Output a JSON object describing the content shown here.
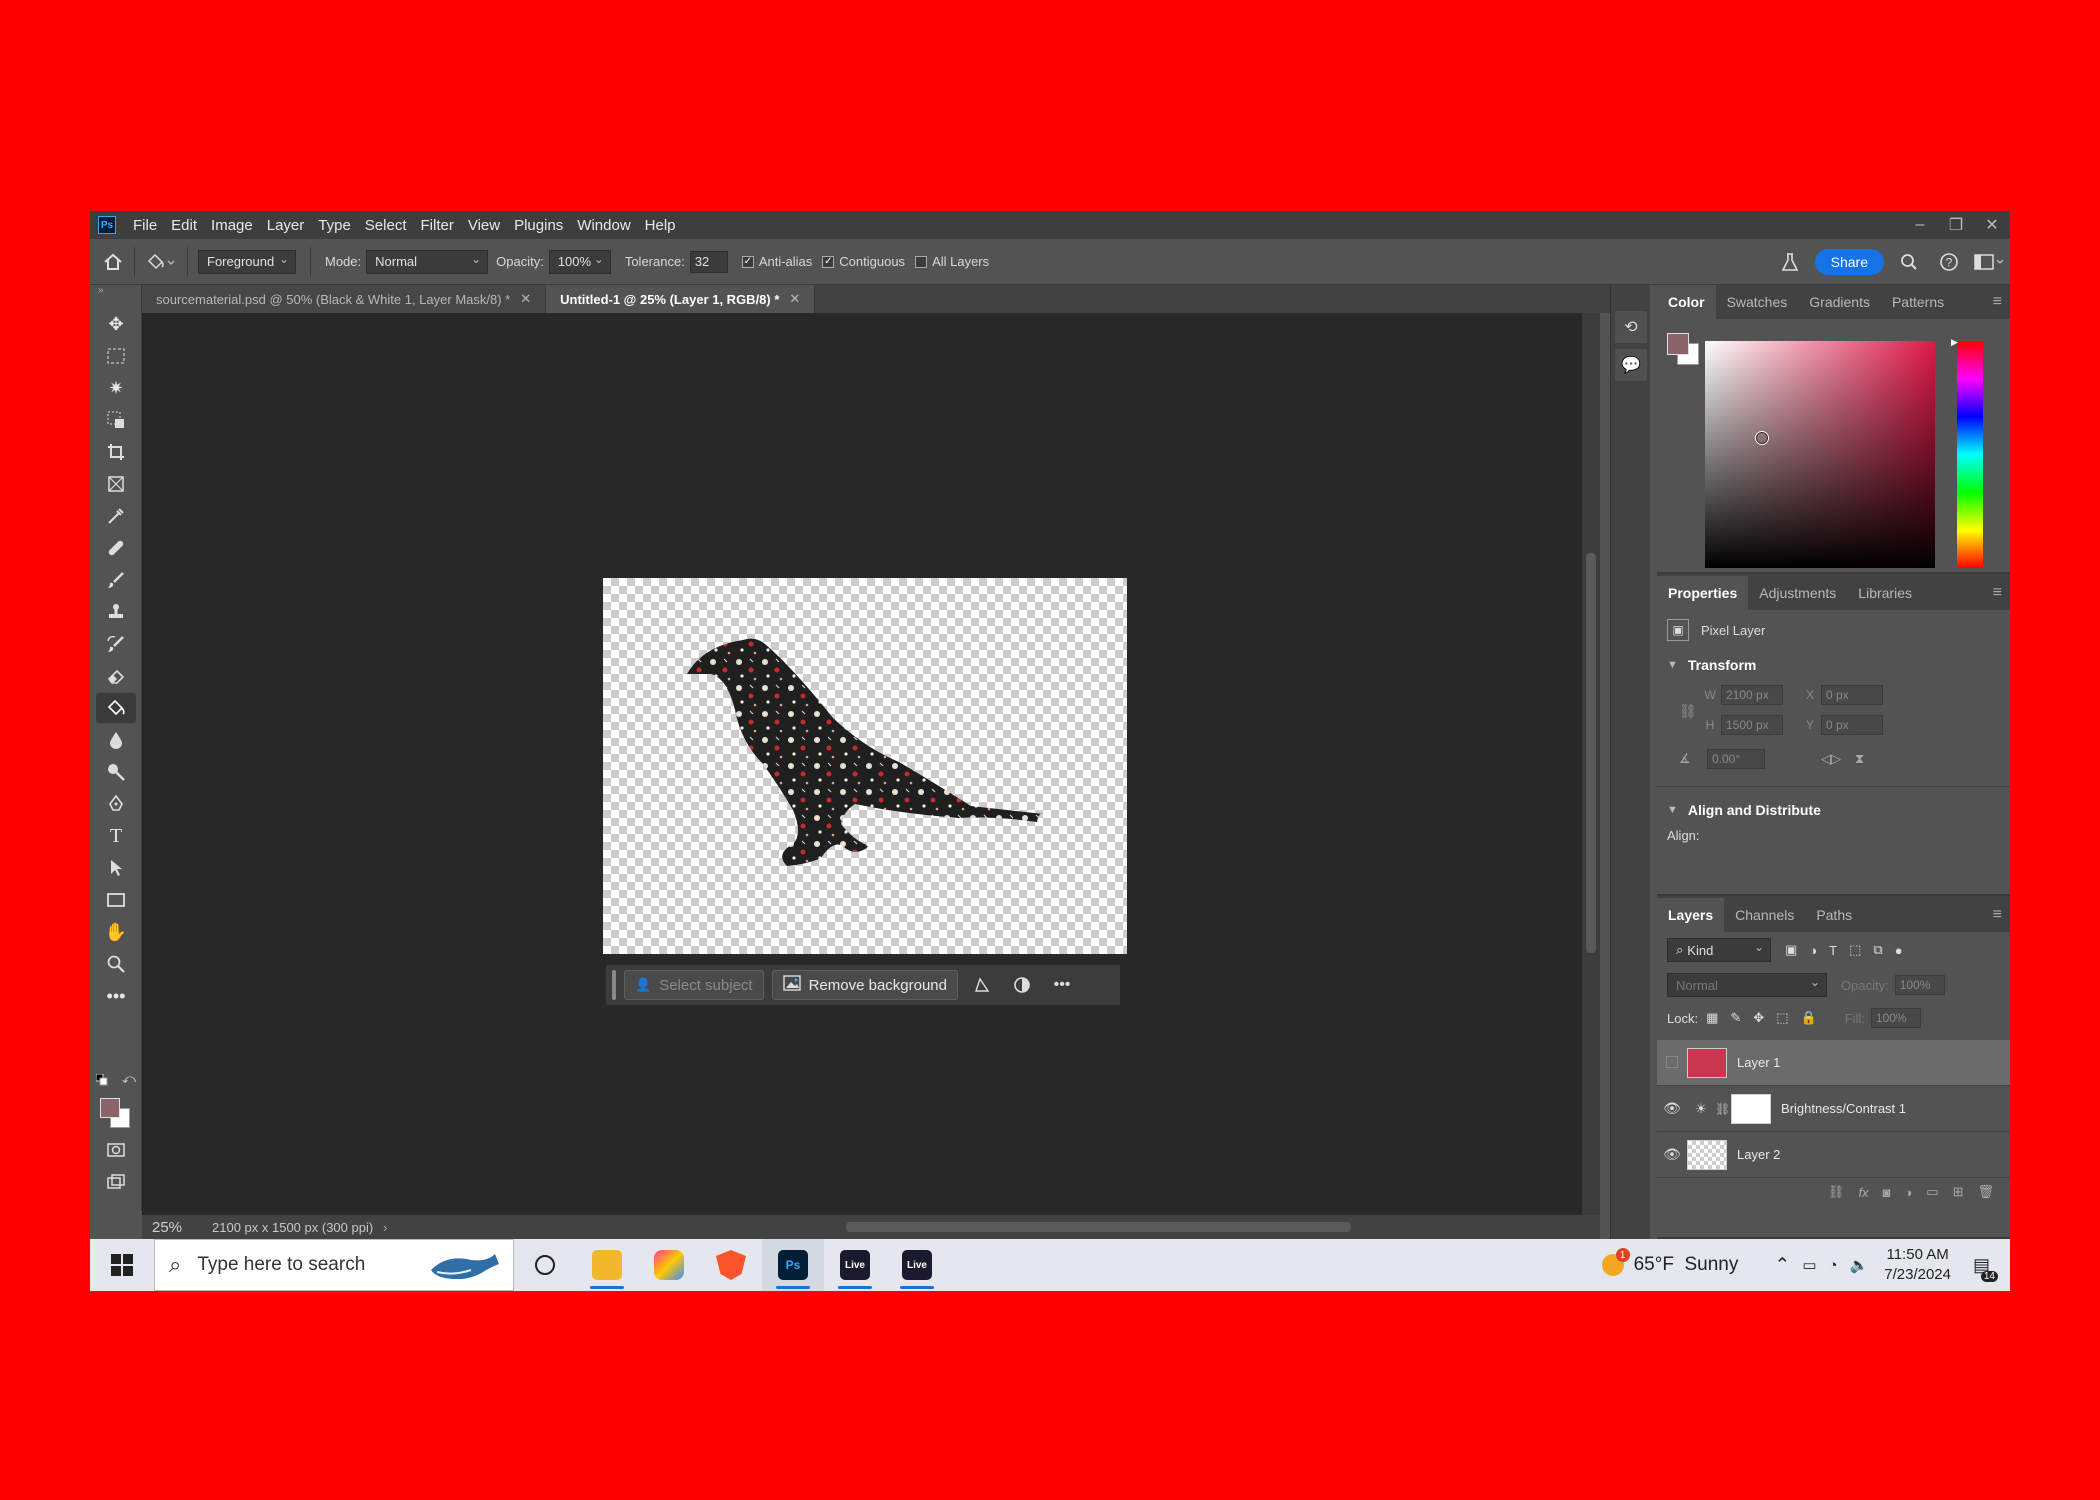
{
  "app": {
    "logo": "Ps"
  },
  "menu": [
    "File",
    "Edit",
    "Image",
    "Layer",
    "Type",
    "Select",
    "Filter",
    "View",
    "Plugins",
    "Window",
    "Help"
  ],
  "window_controls": {
    "minimize": "–",
    "restore": "❐",
    "close": "✕"
  },
  "options": {
    "fill_source": "Foreground",
    "mode_label": "Mode:",
    "mode_value": "Normal",
    "opacity_label": "Opacity:",
    "opacity_value": "100%",
    "tolerance_label": "Tolerance:",
    "tolerance_value": "32",
    "antialias_label": "Anti-alias",
    "contiguous_label": "Contiguous",
    "all_layers_label": "All Layers",
    "share_label": "Share"
  },
  "tabs": [
    {
      "label": "sourcematerial.psd @ 50% (Black & White 1, Layer Mask/8) *",
      "active": false
    },
    {
      "label": "Untitled-1 @ 25% (Layer 1, RGB/8) *",
      "active": true
    }
  ],
  "context_bar": {
    "select_subject": "Select subject",
    "remove_background": "Remove background"
  },
  "status": {
    "zoom": "25%",
    "doc_info": "2100 px x 1500 px (300 ppi)"
  },
  "color_panel": {
    "tabs": [
      "Color",
      "Swatches",
      "Gradients",
      "Patterns"
    ],
    "foreground": "#8c6369",
    "background": "#ffffff"
  },
  "properties_panel": {
    "tabs": [
      "Properties",
      "Adjustments",
      "Libraries"
    ],
    "layer_type": "Pixel Layer",
    "transform_title": "Transform",
    "w_label": "W",
    "w_value": "2100 px",
    "x_label": "X",
    "x_value": "0 px",
    "h_label": "H",
    "h_value": "1500 px",
    "y_label": "Y",
    "y_value": "0 px",
    "angle_value": "0.00°",
    "align_title": "Align and Distribute",
    "align_label": "Align:"
  },
  "layers_panel": {
    "tabs": [
      "Layers",
      "Channels",
      "Paths"
    ],
    "filter_kind": "Kind",
    "blend_mode": "Normal",
    "opacity_label": "Opacity:",
    "opacity_value": "100%",
    "lock_label": "Lock:",
    "fill_label": "Fill:",
    "fill_value": "100%",
    "layers": [
      {
        "name": "Layer 1",
        "visible": false,
        "selected": true,
        "thumb_color": "#c8374f"
      },
      {
        "name": "Brightness/Contrast 1",
        "visible": true,
        "selected": false
      },
      {
        "name": "Layer 2",
        "visible": true,
        "selected": false
      }
    ]
  },
  "taskbar": {
    "search_placeholder": "Type here to search",
    "apps": [
      "Ps",
      "Live",
      "Live"
    ],
    "weather": "65°F  Sunny",
    "weather_badge": "1",
    "time": "11:50 AM",
    "date": "7/23/2024",
    "notifications": "14"
  }
}
